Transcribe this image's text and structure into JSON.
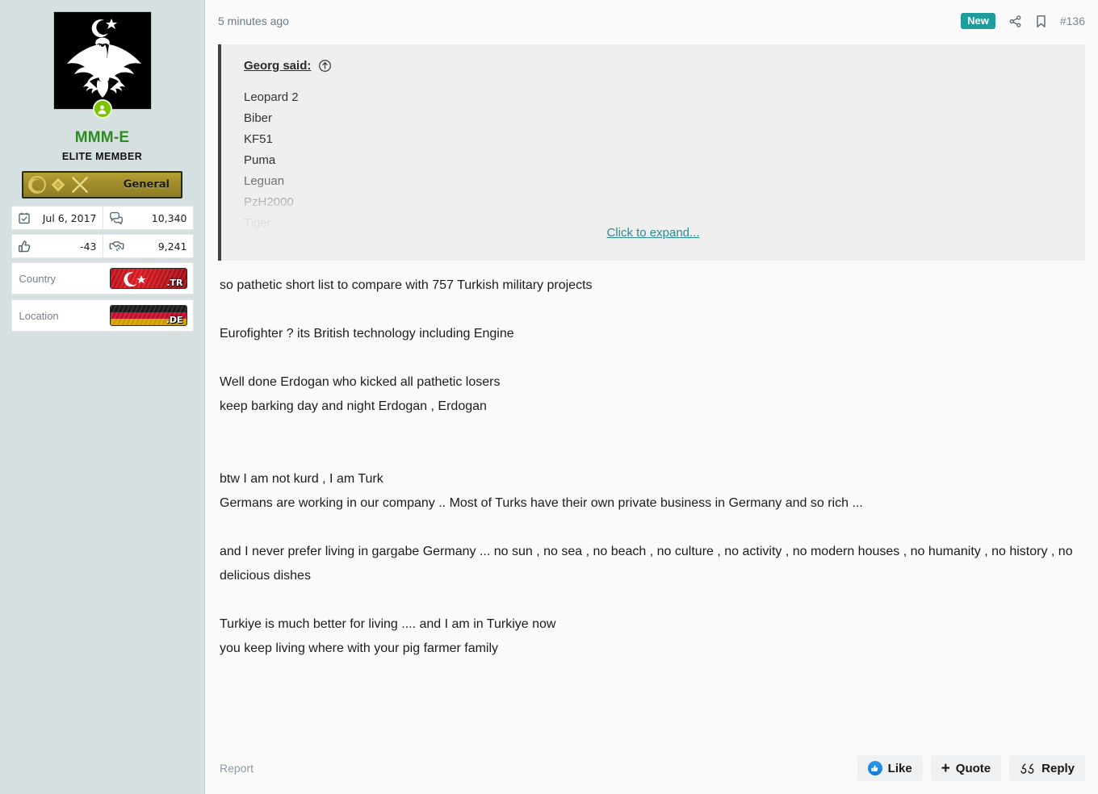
{
  "sidebar": {
    "avatar": {
      "icon": "double-headed-eagle-crescent-avatar",
      "alt": ""
    },
    "online_status_icon": "online-user-badge-icon",
    "username": "MMM-E",
    "user_title": "ELITE MEMBER",
    "rank": {
      "label": "General",
      "icons": [
        "star-crescent-icon",
        "diamond-icon",
        "crossed-swords-icon"
      ]
    },
    "stats": [
      {
        "icon": "calendar-icon",
        "name": "joined-date",
        "value": "Jul 6, 2017"
      },
      {
        "icon": "messages-icon",
        "name": "message-count",
        "value": "10,340"
      },
      {
        "icon": "thumbs-up-icon",
        "name": "reaction-score",
        "value": "-43"
      },
      {
        "icon": "handshake-icon",
        "name": "points-count",
        "value": "9,241"
      }
    ],
    "info": [
      {
        "label": "Country",
        "flag": "turkey-flag",
        "tld": ".TR"
      },
      {
        "label": "Location",
        "flag": "germany-flag",
        "tld": ".DE"
      }
    ]
  },
  "post": {
    "timestamp": "5 minutes ago",
    "new_badge": "New",
    "share_icon": "share-icon",
    "bookmark_icon": "bookmark-icon",
    "post_number": "#136",
    "quote": {
      "author_label": "Georg said:",
      "jump_icon": "jump-to-post-icon",
      "lines": [
        "Leopard 2",
        "Biber",
        "KF51",
        "Puma",
        "Leguan",
        "PzH2000",
        "Tiger"
      ],
      "expand_label": "Click to expand..."
    },
    "paragraphs": [
      [
        "so pathetic short list to compare with 757 Turkish military projects"
      ],
      [
        "Eurofighter ? its British technology including Engine"
      ],
      [
        "Well done Erdogan who kicked all pathetic losers",
        "keep barking day and night Erdogan , Erdogan"
      ],
      [
        "btw I am not kurd , I am Turk",
        "Germans are working in our company .. Most of Turks have their own private business in Germany and so rich ..."
      ],
      [
        "and I never prefer living in gargabe Germany ... no sun , no sea , no beach , no culture , no activity , no modern houses , no humanity , no history , no delicious dishes"
      ],
      [
        "Turkiye is much better for living .... and I am in Turkiye now",
        "you keep living where with your pig farmer family"
      ]
    ],
    "footer": {
      "report_label": "Report",
      "like_label": "Like",
      "quote_label": "Quote",
      "reply_label": "Reply",
      "quote_plus": "+"
    }
  },
  "colors": {
    "sidebar_bg": "#d7e0e0",
    "username_green": "#2e8b22",
    "new_badge_teal": "#1f9d9d",
    "expand_link_teal": "#2c8b93",
    "quote_bg": "#efefef",
    "quote_border": "#3a4448",
    "like_blue": "#1578d4"
  }
}
